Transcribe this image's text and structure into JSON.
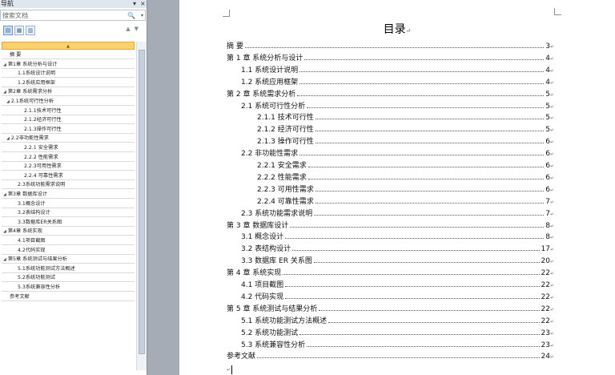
{
  "nav": {
    "title": "导航",
    "pin_icon": "chevron-down-icon",
    "close_label": "×",
    "search_placeholder": "搜索文档",
    "search_icon": "🔍",
    "dropdown": "▾",
    "tab1": "▤",
    "tab2": "▦",
    "tab3": "▥",
    "up_arrow": "▲",
    "down_arrow": "▼",
    "items": [
      {
        "label": "摘    要",
        "level": 0,
        "tri": ""
      },
      {
        "label": "第1章  系统分析与设计",
        "level": 0,
        "tri": "◢"
      },
      {
        "label": "1.1系统设计说明",
        "level": 2,
        "tri": ""
      },
      {
        "label": "1.2系统应用框架",
        "level": 2,
        "tri": ""
      },
      {
        "label": "第2章  系统需求分析",
        "level": 0,
        "tri": "◢"
      },
      {
        "label": "2.1系统可行性分析",
        "level": 1,
        "tri": "◢"
      },
      {
        "label": "2.1.1技术可行性",
        "level": 3,
        "tri": ""
      },
      {
        "label": "2.1.2经济可行性",
        "level": 3,
        "tri": ""
      },
      {
        "label": "2.1.3操作可行性",
        "level": 3,
        "tri": ""
      },
      {
        "label": "2.2非功能性需求",
        "level": 1,
        "tri": "◢"
      },
      {
        "label": "2.2.1  安全需求",
        "level": 3,
        "tri": ""
      },
      {
        "label": "2.2.2  性能需求",
        "level": 3,
        "tri": ""
      },
      {
        "label": "2.2.3可用性需求",
        "level": 3,
        "tri": ""
      },
      {
        "label": "2.2.4  可靠性需求",
        "level": 3,
        "tri": ""
      },
      {
        "label": "2.3系统功能需求说明",
        "level": 2,
        "tri": ""
      },
      {
        "label": "第3章  数据库设计",
        "level": 0,
        "tri": "◢"
      },
      {
        "label": "3.1概念设计",
        "level": 2,
        "tri": ""
      },
      {
        "label": "3.2表结构设计",
        "level": 2,
        "tri": ""
      },
      {
        "label": "3.3数据库ER关系图",
        "level": 2,
        "tri": ""
      },
      {
        "label": "第4章  系统实现",
        "level": 0,
        "tri": "◢"
      },
      {
        "label": "4.1项目截图",
        "level": 2,
        "tri": ""
      },
      {
        "label": "4.2代码实现",
        "level": 2,
        "tri": ""
      },
      {
        "label": "第5章  系统测试与结果分析",
        "level": 0,
        "tri": "◢"
      },
      {
        "label": "5.1系统功能测试方法概述",
        "level": 2,
        "tri": ""
      },
      {
        "label": "5.2系统功能测试",
        "level": 2,
        "tri": ""
      },
      {
        "label": "5.3系统兼容性分析",
        "level": 2,
        "tri": ""
      },
      {
        "label": "参考文献",
        "level": 0,
        "tri": ""
      }
    ]
  },
  "doc": {
    "toc_title": "目录",
    "para_mark": "↵",
    "toc": [
      {
        "label": "摘    要",
        "page": "3",
        "level": 0
      },
      {
        "label": "第 1 章       系统分析与设计",
        "page": "4",
        "level": 0
      },
      {
        "label": "1.1  系统设计说明",
        "page": "4",
        "level": 1
      },
      {
        "label": "1.2  系统应用框架",
        "page": "4",
        "level": 1
      },
      {
        "label": "第 2 章  系统需求分析",
        "page": "5",
        "level": 0
      },
      {
        "label": "2.1  系统可行性分析",
        "page": "5",
        "level": 1
      },
      {
        "label": "2.1.1  技术可行性",
        "page": "5",
        "level": 2
      },
      {
        "label": "2.1.2  经济可行性",
        "page": "5",
        "level": 2
      },
      {
        "label": "2.1.3  操作可行性",
        "page": "6",
        "level": 2
      },
      {
        "label": "2.2  非功能性需求",
        "page": "6",
        "level": 1
      },
      {
        "label": "2.2.1   安全需求",
        "page": "6",
        "level": 2
      },
      {
        "label": "2.2.2   性能需求",
        "page": "6",
        "level": 2
      },
      {
        "label": "2.2.3  可用性需求",
        "page": "6",
        "level": 2
      },
      {
        "label": "2.2.4   可靠性需求",
        "page": "7",
        "level": 2
      },
      {
        "label": "2.3  系统功能需求说明",
        "page": "7",
        "level": 1
      },
      {
        "label": "第 3 章  数据库设计",
        "page": "8",
        "level": 0
      },
      {
        "label": "3.1  概念设计",
        "page": "8",
        "level": 1
      },
      {
        "label": "3.2  表结构设计",
        "page": "17",
        "level": 1
      },
      {
        "label": "3.3  数据库 ER 关系图",
        "page": "20",
        "level": 1
      },
      {
        "label": "第 4 章  系统实现",
        "page": "22",
        "level": 0
      },
      {
        "label": "4.1  项目截图",
        "page": "22",
        "level": 1
      },
      {
        "label": "4.2  代码实现",
        "page": "22",
        "level": 1
      },
      {
        "label": "第 5 章  系统测试与结果分析",
        "page": "22",
        "level": 0
      },
      {
        "label": "5.1  系统功能测试方法概述",
        "page": "22",
        "level": 1
      },
      {
        "label": "5.2  系统功能测试",
        "page": "23",
        "level": 1
      },
      {
        "label": "5.3  系统兼容性分析",
        "page": "23",
        "level": 1
      },
      {
        "label": "参考文献",
        "page": "24",
        "level": 0
      }
    ]
  }
}
